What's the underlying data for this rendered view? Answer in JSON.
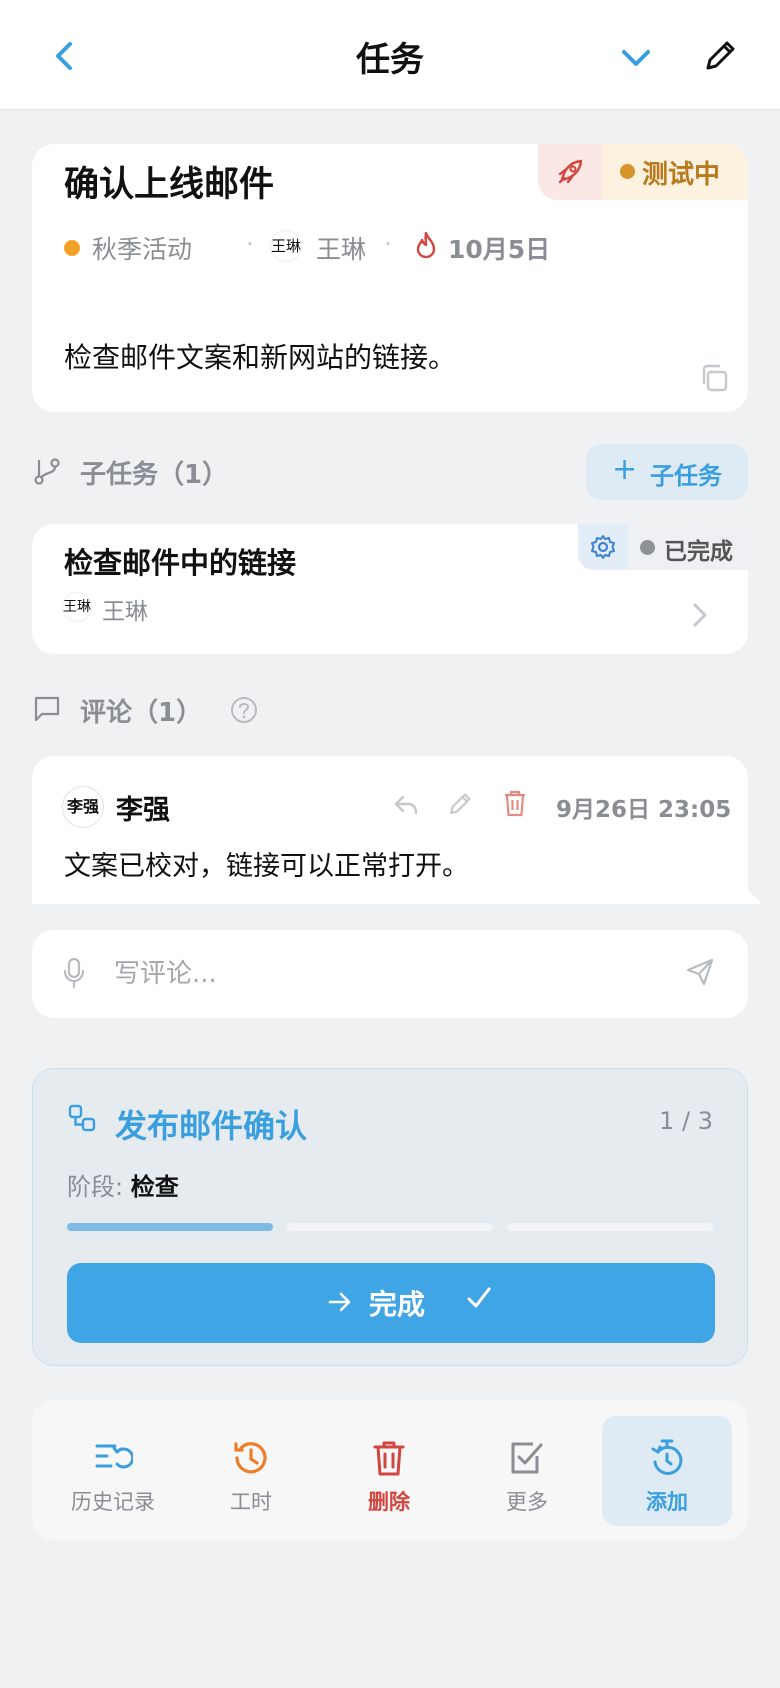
{
  "header": {
    "title": "任务"
  },
  "task": {
    "title": "确认上线邮件",
    "status": "测试中",
    "campaign": "秋季活动",
    "assignee_avatar": "王琳",
    "assignee": "王琳",
    "due": "10月5日",
    "description": "检查邮件文案和新网站的链接。",
    "meta_separator": "·"
  },
  "subtasks": {
    "heading": "子任务（1）",
    "add_plus": "+",
    "add_label": "子任务",
    "items": [
      {
        "name": "检查邮件中的链接",
        "status": "已完成",
        "assignee_avatar": "王琳",
        "assignee": "王琳"
      }
    ]
  },
  "comments": {
    "heading": "评论（1）",
    "items": [
      {
        "avatar": "李强",
        "author": "李强",
        "time": "9月26日 23:05",
        "text": "文案已校对，链接可以正常打开。"
      }
    ],
    "input_placeholder": "写评论..."
  },
  "workflow": {
    "title": "发布邮件确认",
    "step": "1 / 3",
    "stage_label": "阶段:",
    "stage_value": "检查",
    "progress_fraction": 0.3333,
    "done_label": "完成"
  },
  "toolbar": {
    "items": [
      {
        "label": "历史记录",
        "icon": "history-list-icon"
      },
      {
        "label": "工时",
        "icon": "clock-history-icon"
      },
      {
        "label": "删除",
        "icon": "trash-icon"
      },
      {
        "label": "更多",
        "icon": "checkbox-icon"
      },
      {
        "label": "添加",
        "icon": "timer-add-icon"
      }
    ]
  },
  "colors": {
    "accent": "#3fa5e4",
    "status_testing": "#b77b1e",
    "danger": "#d2463f",
    "campaign_dot": "#f2a126"
  }
}
